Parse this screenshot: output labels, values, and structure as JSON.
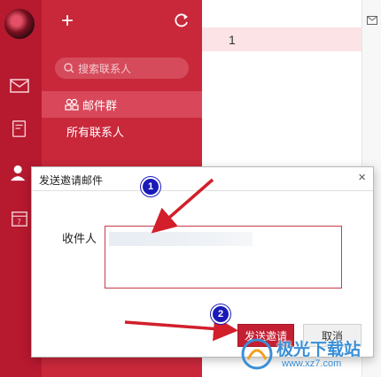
{
  "app": {
    "toolbar": {
      "plus_glyph": "+"
    },
    "search": {
      "placeholder": "搜索联系人"
    },
    "nav": [
      {
        "label": "邮件群",
        "active": true
      },
      {
        "label": "所有联系人",
        "active": false
      }
    ],
    "list": {
      "row_value": "1"
    }
  },
  "dialog": {
    "title": "发送邀请邮件",
    "close_glyph": "×",
    "recipient_label": "收件人",
    "send_label": "发送邀请",
    "cancel_label": "取消"
  },
  "annotations": {
    "badge1": "1",
    "badge2": "2"
  },
  "watermark": {
    "text": "极光下载站",
    "url": "www.xz7.com"
  },
  "colors": {
    "rail": "#b7192f",
    "panel": "#c9283b",
    "active": "#d9485a",
    "badge": "#1a1ab8",
    "arrow": "#d21f2b"
  }
}
